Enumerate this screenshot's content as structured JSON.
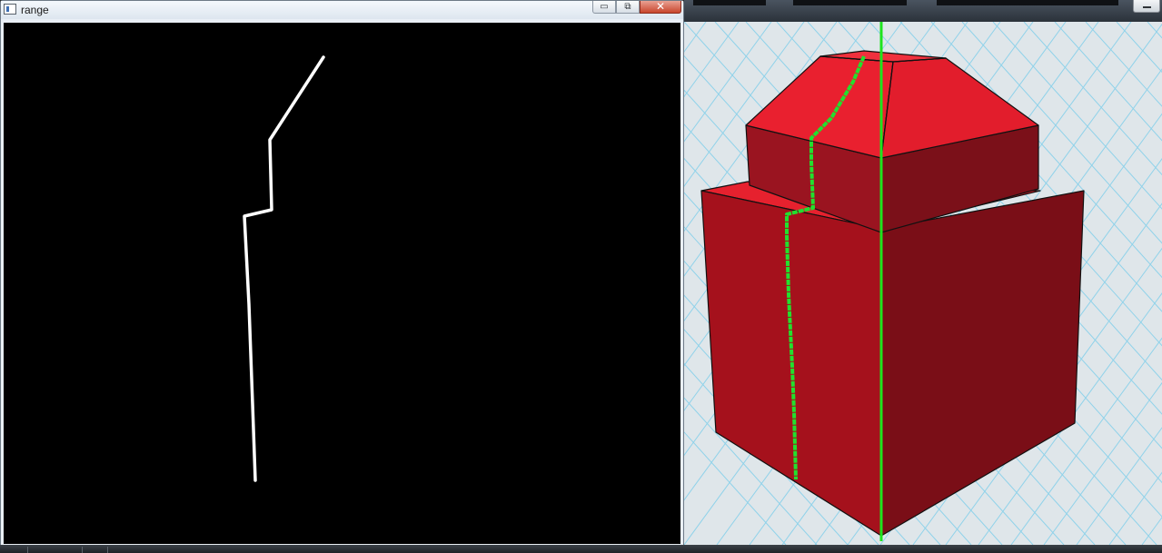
{
  "range_window": {
    "title": "range",
    "app_icon": "window-app-icon",
    "minimize_icon": "minimize-icon",
    "maximize_icon": "maximize-icon",
    "close_icon": "close-icon",
    "minimize_glyph": "▭",
    "maximize_glyph": "⧉",
    "close_glyph": "✕",
    "canvas_background": "#000000",
    "trace_color": "#ffffff"
  },
  "viewport_window": {
    "restore_icon": "restore-icon",
    "grid_line_color": "#8fd2ea",
    "background_color": "#dfe6ea",
    "model_color": "#e81e2d",
    "edge_color": "#111111",
    "cut_path_color": "#22e02e",
    "axis_line_color": "#1ee41e"
  },
  "taskbar": {
    "color": "#2a2f35"
  }
}
